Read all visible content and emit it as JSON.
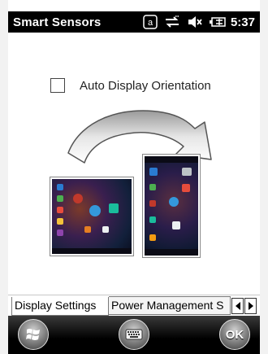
{
  "status_bar": {
    "app_title": "Smart Sensors",
    "time": "5:37",
    "icons": [
      "notification-a-icon",
      "connectivity-icon",
      "volume-muted-icon",
      "battery-charging-icon"
    ]
  },
  "content": {
    "auto_display_orientation": {
      "label": "Auto Display Orientation",
      "checked": false
    },
    "illustration": {
      "landscape_label": "",
      "portrait_label": ""
    }
  },
  "tabs": [
    {
      "label": "Display Settings",
      "active": true
    },
    {
      "label": "Power Management S",
      "active": false
    }
  ],
  "softkeys": {
    "left": "start-icon",
    "center": "keyboard-icon",
    "right_label": "OK"
  },
  "colors": {
    "statusbar_bg": "#000000",
    "softbar_bg": "#1a1a1a",
    "text": "#222222"
  }
}
